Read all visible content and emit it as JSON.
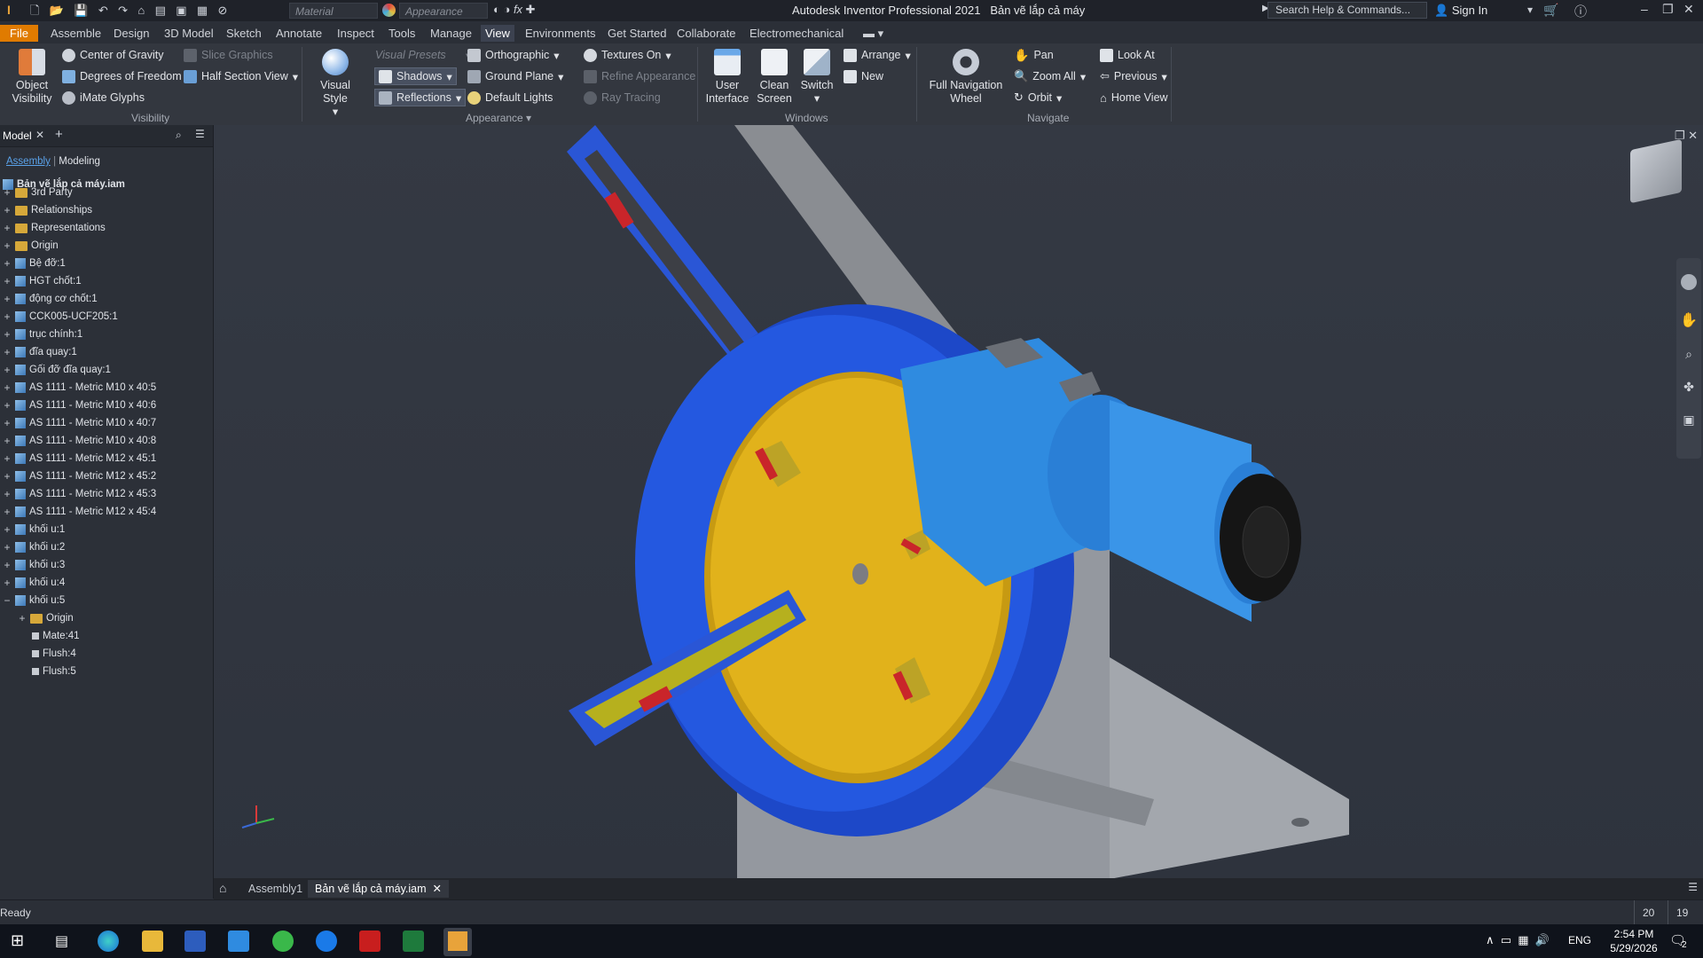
{
  "titlebar": {
    "material_placeholder": "Material",
    "appearance_placeholder": "Appearance",
    "app_title": "Autodesk Inventor Professional 2021",
    "doc_title": "Bản vẽ lắp cả máy",
    "search_placeholder": "Search Help & Commands...",
    "sign_in": "Sign In"
  },
  "menu_tabs": [
    "File",
    "Assemble",
    "Design",
    "3D Model",
    "Sketch",
    "Annotate",
    "Inspect",
    "Tools",
    "Manage",
    "View",
    "Environments",
    "Get Started",
    "Collaborate",
    "Electromechanical"
  ],
  "active_tab": "View",
  "ribbon": {
    "visibility": {
      "object_visibility": "Object\nVisibility",
      "center_of_gravity": "Center of Gravity",
      "degrees_of_freedom": "Degrees of Freedom",
      "imate_glyphs": "iMate Glyphs",
      "slice_graphics": "Slice Graphics",
      "half_section_view": "Half Section View",
      "label": "Visibility"
    },
    "appearance": {
      "visual_style": "Visual Style",
      "visual_presets": "Visual Presets",
      "shadows": "Shadows",
      "reflections": "Reflections",
      "orthographic": "Orthographic",
      "ground_plane": "Ground Plane",
      "default_lights": "Default Lights",
      "textures_on": "Textures On",
      "refine_appearance": "Refine Appearance",
      "ray_tracing": "Ray Tracing",
      "label": "Appearance"
    },
    "windows": {
      "user_interface": "User\nInterface",
      "clean_screen": "Clean\nScreen",
      "switch": "Switch",
      "arrange": "Arrange",
      "new": "New",
      "label": "Windows"
    },
    "navigate": {
      "full_navigation_wheel": "Full Navigation\nWheel",
      "pan": "Pan",
      "zoom_all": "Zoom All",
      "orbit": "Orbit",
      "look_at": "Look At",
      "previous": "Previous",
      "home_view": "Home View",
      "label": "Navigate"
    }
  },
  "browser": {
    "tab": "Model",
    "sub_tabs": [
      "Assembly",
      "Modeling"
    ],
    "root": "Bản vẽ lắp cả máy.iam",
    "items": [
      "3rd Party",
      "Relationships",
      "Representations",
      "Origin",
      "Bệ đỡ:1",
      "HGT chốt:1",
      "động cơ chốt:1",
      "CCK005-UCF205:1",
      "trục chính:1",
      "đĩa quay:1",
      "Gối đỡ đĩa quay:1",
      "AS 1111 - Metric M10 x 40:5",
      "AS 1111 - Metric M10 x 40:6",
      "AS 1111 - Metric M10 x 40:7",
      "AS 1111 - Metric M10 x 40:8",
      "AS 1111 - Metric M12 x 45:1",
      "AS 1111 - Metric M12 x 45:2",
      "AS 1111 - Metric M12 x 45:3",
      "AS 1111 - Metric M12 x 45:4",
      "khối u:1",
      "khối u:2",
      "khối u:3",
      "khối u:4",
      "khối u:5"
    ],
    "children": [
      "Origin",
      "Mate:41",
      "Flush:4",
      "Flush:5"
    ]
  },
  "doc_tabs": [
    "Assembly1",
    "Bản vẽ lắp cả máy.iam"
  ],
  "status": {
    "text": "Ready",
    "count1": "20",
    "count2": "19"
  },
  "taskbar": {
    "lang": "ENG",
    "time": "2:54 PM",
    "date": "5/29/2026",
    "notif": "2"
  },
  "colors": {
    "accent_file": "#e07b00",
    "disk_blue": "#1f4fd8",
    "disk_yellow": "#e3b21a",
    "motor_blue": "#2f8be0"
  }
}
